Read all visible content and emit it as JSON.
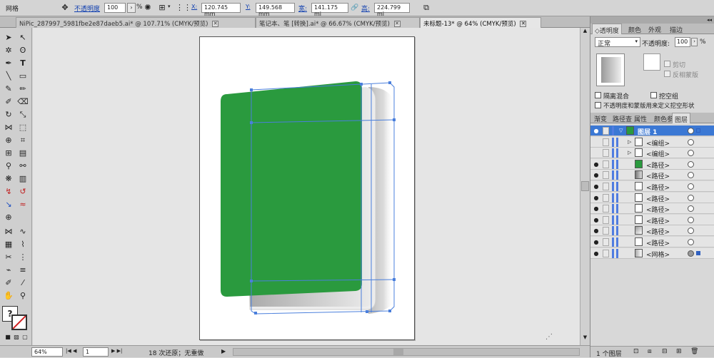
{
  "control": {
    "object_type": "网格",
    "opacity_label": "不透明度",
    "opacity_value": "100",
    "opacity_unit": "%",
    "x_label": "X:",
    "x_value": "120.745 mm",
    "y_label": "Y:",
    "y_value": "149.568 mm",
    "w_label": "宽:",
    "w_value": "141.175 mi",
    "h_label": "高:",
    "h_value": "224.799 mi"
  },
  "tabs": [
    {
      "label": "NiPic_287997_5981fbe2e87daeb5.ai* @ 107.71% (CMYK/预览)",
      "close": "✕"
    },
    {
      "label": "笔记本、笔 [转换].ai* @ 66.67% (CMYK/预览)",
      "close": "✕"
    },
    {
      "label": "未标题-13* @ 64% (CMYK/预览)",
      "close": "✕"
    }
  ],
  "status": {
    "zoom": "64%",
    "page": "1",
    "history": "18 次还原；无重做",
    "play": "▶"
  },
  "transparency_panel": {
    "tabs": [
      "◇透明度",
      "颜色",
      "外观",
      "描边"
    ],
    "blend_mode": "正常",
    "opacity_label": "不透明度:",
    "opacity_value": "100",
    "opacity_unit": "%",
    "clip_label": "剪切",
    "invert_label": "反相蒙版",
    "isolate_label": "隔离混合",
    "knockout_label": "挖空组",
    "define_knockout_label": "不透明度和蒙版用来定义挖空形状"
  },
  "layers_panel": {
    "tabs": [
      "渐变",
      "路径查",
      "属性",
      "颜色参",
      "图层"
    ],
    "rows": [
      {
        "name": "图层 1",
        "selected": true,
        "eye": true,
        "thumb": "green",
        "expanded": true
      },
      {
        "name": "<编组>",
        "eye": false,
        "thumb": "group",
        "expander": true
      },
      {
        "name": "<编组>",
        "eye": false,
        "thumb": "group",
        "expander": true
      },
      {
        "name": "<路径>",
        "eye": true,
        "thumb": "green-fill"
      },
      {
        "name": "<路径>",
        "eye": true,
        "thumb": "gray-fill"
      },
      {
        "name": "<路径>",
        "eye": true,
        "thumb": "empty"
      },
      {
        "name": "<路径>",
        "eye": true,
        "thumb": "empty"
      },
      {
        "name": "<路径>",
        "eye": true,
        "thumb": "empty"
      },
      {
        "name": "<路径>",
        "eye": true,
        "thumb": "empty"
      },
      {
        "name": "<路径>",
        "eye": true,
        "thumb": "gradient"
      },
      {
        "name": "<路径>",
        "eye": true,
        "thumb": "empty"
      },
      {
        "name": "<网格>",
        "eye": true,
        "thumb": "mesh",
        "target_filled": true
      }
    ],
    "footer_count": "1 个图层"
  },
  "colors": {
    "accent": "#3b78d4",
    "cover_green": "#2a9a3e",
    "selection_blue": "#4a7fdc"
  }
}
